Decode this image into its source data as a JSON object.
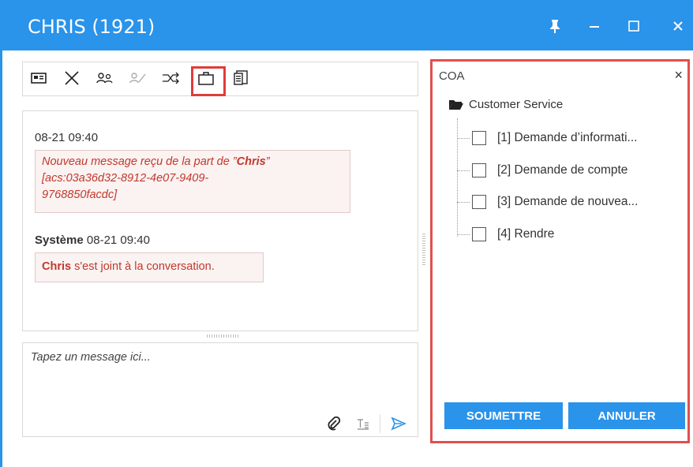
{
  "window": {
    "title": "CHRIS (1921)",
    "pin_icon": "pin-icon",
    "minimize_icon": "minimize-icon",
    "maximize_icon": "maximize-icon",
    "close_icon": "close-icon"
  },
  "toolbar": {
    "icons": [
      "contact-card-icon",
      "close-x-icon",
      "consult-icon",
      "disabled-consult-icon",
      "transfer-icon",
      "briefcase-icon",
      "document-icon"
    ],
    "highlighted": "briefcase-icon"
  },
  "chat": {
    "messages": [
      {
        "timestamp": "08-21 09:40",
        "text_before": "Nouveau message reçu de la part de ",
        "quote_open": "”",
        "sender": "Chris",
        "quote_close": "”",
        "line2": "[acs:03a36d32-8912-4e07-9409-",
        "line3": "9768850facdc]"
      },
      {
        "author": "Système",
        "timestamp": "08-21 09:40",
        "name": "Chris",
        "text": " s'est joint à la conversation."
      }
    ]
  },
  "composer": {
    "placeholder": "Tapez un message ici...",
    "icons": [
      "attach-icon",
      "text-format-icon",
      "send-icon"
    ]
  },
  "coa_panel": {
    "label": "COA",
    "close": "×",
    "root": "Customer Service",
    "items": [
      "[1] Demande d’informati...",
      "[2] Demande de compte",
      "[3] Demande de nouvea...",
      "[4] Rendre"
    ],
    "submit_label": "SOUMETTRE",
    "cancel_label": "ANNULER"
  },
  "colors": {
    "accent": "#2a93ea",
    "highlight": "#e05050",
    "message_text": "#c0392b"
  }
}
